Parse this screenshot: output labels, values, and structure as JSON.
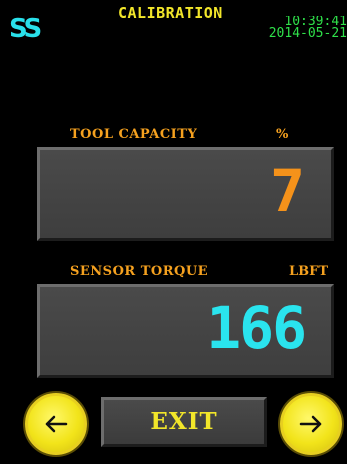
{
  "header": {
    "logo": "SS",
    "title": "CALIBRATION",
    "time": "10:39:41",
    "date": "2014-05-21"
  },
  "tool_capacity": {
    "label": "TOOL CAPACITY",
    "unit": "%",
    "value": "7"
  },
  "sensor_torque": {
    "label": "SENSOR TORQUE",
    "unit": "LBFT",
    "value": "166"
  },
  "footer": {
    "exit_label": "EXIT",
    "prev_icon": "arrow-left-icon",
    "next_icon": "arrow-right-icon"
  },
  "colors": {
    "background": "#000000",
    "logo": "#29e0ea",
    "title": "#f2e62a",
    "clock": "#2fe04a",
    "label": "#f5a11f",
    "tool_value": "#f5921a",
    "torque_value": "#2ae4ee",
    "button_yellow": "#f2e41a",
    "panel": "#444444"
  }
}
